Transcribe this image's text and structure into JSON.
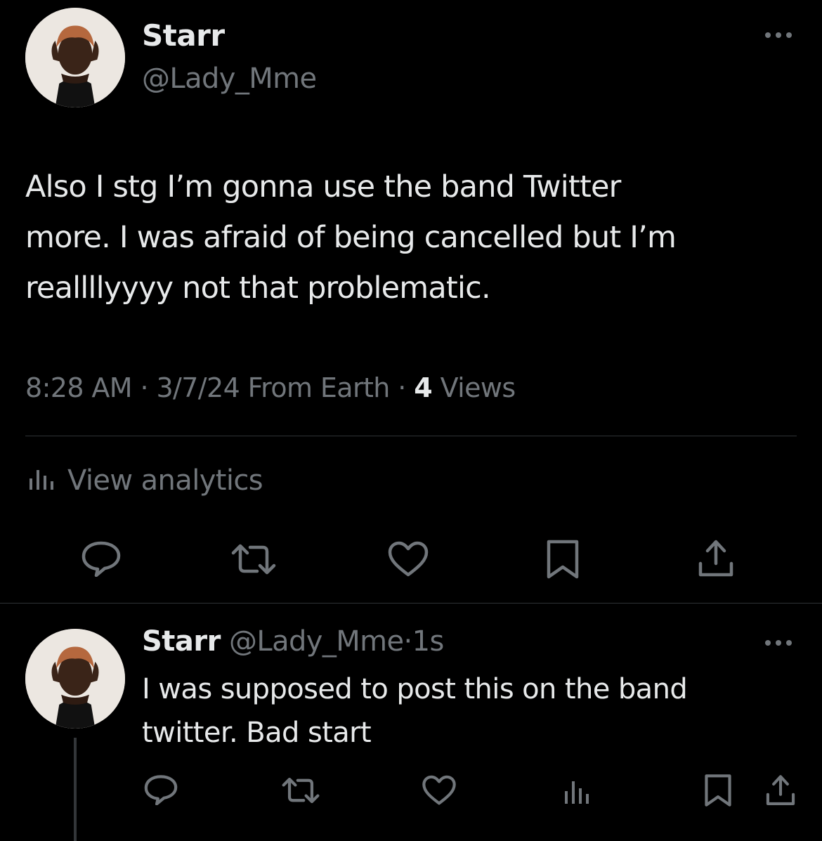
{
  "main_tweet": {
    "author_name": "Starr",
    "author_handle": "@Lady_Mme",
    "text_lines": [
      "Also I stg I’m gonna use the band Twitter",
      "more. I was afraid of being cancelled but I’m",
      "reallllyyyy not that problematic."
    ],
    "time": "8:28 AM",
    "sep1": "·",
    "date_location": "3/7/24 From Earth",
    "sep2": "·",
    "views_count": "4",
    "views_label": "Views",
    "analytics_label": "View analytics",
    "icons": {
      "more": "more-horizontal-icon",
      "analytics": "bar-chart-icon",
      "reply": "reply-icon",
      "retweet": "retweet-icon",
      "like": "heart-icon",
      "bookmark": "bookmark-icon",
      "share": "share-icon"
    }
  },
  "reply_tweet": {
    "author_name": "Starr",
    "author_handle": "@Lady_Mme",
    "sep": "·",
    "time_ago": "1s",
    "text_lines": [
      "I was supposed to post this on the band",
      "twitter. Bad start"
    ],
    "icons": {
      "more": "more-horizontal-icon",
      "reply": "reply-icon",
      "retweet": "retweet-icon",
      "like": "heart-icon",
      "views": "bar-chart-icon",
      "bookmark": "bookmark-icon",
      "share": "share-icon"
    }
  },
  "colors": {
    "background": "#000000",
    "text_primary": "#e7e9ea",
    "text_secondary": "#71767b",
    "divider": "#2f3336"
  }
}
